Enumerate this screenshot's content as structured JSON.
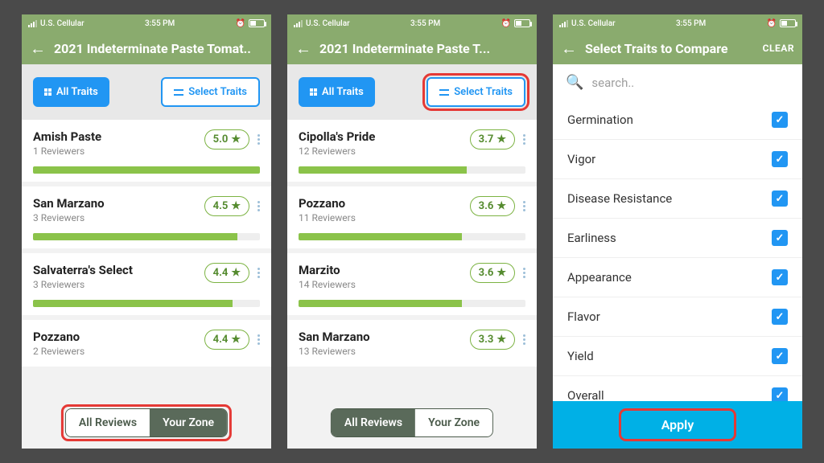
{
  "status": {
    "carrier": "U.S. Cellular",
    "time": "3:55 PM"
  },
  "screen1": {
    "title": "2021 Indeterminate Paste Tomat..",
    "all_traits": "All Traits",
    "select_traits": "Select Traits",
    "items": [
      {
        "name": "Amish Paste",
        "sub": "1 Reviewers",
        "rating": "5.0",
        "bar": 100
      },
      {
        "name": "San Marzano",
        "sub": "3 Reviewers",
        "rating": "4.5",
        "bar": 90
      },
      {
        "name": "Salvaterra's Select",
        "sub": "3 Reviewers",
        "rating": "4.4",
        "bar": 88
      },
      {
        "name": "Pozzano",
        "sub": "2 Reviewers",
        "rating": "4.4"
      }
    ],
    "seg_all": "All  Reviews",
    "seg_zone": "Your Zone",
    "active_seg": "zone"
  },
  "screen2": {
    "title": "2021 Indeterminate Paste T...",
    "all_traits": "All Traits",
    "select_traits": "Select Traits",
    "items": [
      {
        "name": "Cipolla's Pride",
        "sub": "12 Reviewers",
        "rating": "3.7",
        "bar": 74
      },
      {
        "name": "Pozzano",
        "sub": "11 Reviewers",
        "rating": "3.6",
        "bar": 72
      },
      {
        "name": "Marzito",
        "sub": "14 Reviewers",
        "rating": "3.6",
        "bar": 72
      },
      {
        "name": "San Marzano",
        "sub": "13 Reviewers",
        "rating": "3.3"
      }
    ],
    "seg_all": "All  Reviews",
    "seg_zone": "Your Zone",
    "active_seg": "all"
  },
  "screen3": {
    "title": "Select Traits to Compare",
    "clear": "CLEAR",
    "search_placeholder": "search..",
    "traits": [
      "Germination",
      "Vigor",
      "Disease Resistance",
      "Earliness",
      "Appearance",
      "Flavor",
      "Yield",
      "Overall"
    ],
    "apply": "Apply"
  }
}
